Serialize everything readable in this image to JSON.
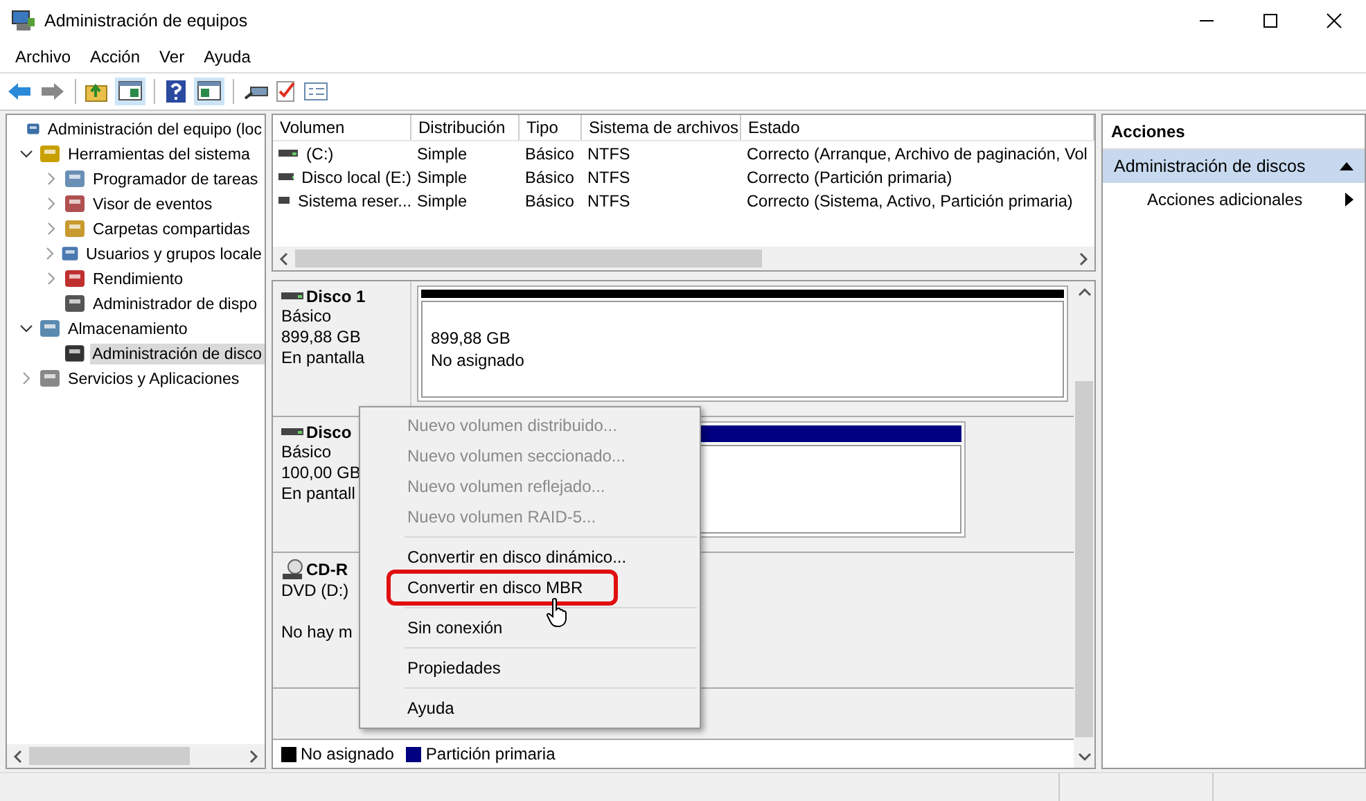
{
  "window": {
    "title": "Administración de equipos"
  },
  "menu": [
    "Archivo",
    "Acción",
    "Ver",
    "Ayuda"
  ],
  "tree": [
    {
      "label": "Administración del equipo (loc",
      "selected": false,
      "children": [
        {
          "label": "Herramientas del sistema",
          "expanded": true,
          "selected": false,
          "children": [
            {
              "label": "Programador de tareas",
              "expanded": false,
              "selected": false
            },
            {
              "label": "Visor de eventos",
              "expanded": false,
              "selected": false
            },
            {
              "label": "Carpetas compartidas",
              "expanded": false,
              "selected": false
            },
            {
              "label": "Usuarios y grupos locale",
              "expanded": false,
              "selected": false
            },
            {
              "label": "Rendimiento",
              "expanded": false,
              "selected": false
            },
            {
              "label": "Administrador de dispo",
              "selected": false
            }
          ]
        },
        {
          "label": "Almacenamiento",
          "expanded": true,
          "selected": false,
          "children": [
            {
              "label": "Administración de disco",
              "selected": true
            }
          ]
        },
        {
          "label": "Servicios y Aplicaciones",
          "expanded": false,
          "selected": false
        }
      ]
    }
  ],
  "volumes": {
    "columns": [
      "Volumen",
      "Distribución",
      "Tipo",
      "Sistema de archivos",
      "Estado"
    ],
    "rows": [
      [
        "(C:)",
        "Simple",
        "Básico",
        "NTFS",
        "Correcto (Arranque, Archivo de paginación, Vol"
      ],
      [
        "Disco local (E:)",
        "Simple",
        "Básico",
        "NTFS",
        "Correcto (Partición primaria)"
      ],
      [
        "Sistema reser...",
        "Simple",
        "Básico",
        "NTFS",
        "Correcto (Sistema, Activo, Partición primaria)"
      ]
    ]
  },
  "disks": [
    {
      "kind": "disk",
      "name": "Disco 1",
      "lines": [
        "Básico",
        "899,88 GB",
        "En pantalla"
      ],
      "partition": {
        "color": "#000000",
        "size": "899,88 GB",
        "status": "No asignado"
      }
    },
    {
      "kind": "disk",
      "name": "Disco",
      "lines": [
        "Básico",
        "100,00 GB",
        "En pantall"
      ],
      "partition": {
        "color": "#000080"
      }
    },
    {
      "kind": "cdrom",
      "name": "CD-R",
      "lines": [
        "DVD (D:)"
      ],
      "note": "No hay m"
    }
  ],
  "legend": [
    {
      "label": "No asignado",
      "color": "#000000"
    },
    {
      "label": "Partición primaria",
      "color": "#000080"
    }
  ],
  "context_menu": [
    [
      {
        "label": "Nuevo volumen distribuido...",
        "disabled": true,
        "selected": false
      },
      {
        "label": "Nuevo volumen seccionado...",
        "disabled": true,
        "selected": false
      },
      {
        "label": "Nuevo volumen reflejado...",
        "disabled": true,
        "selected": false
      },
      {
        "label": "Nuevo volumen RAID-5...",
        "disabled": true,
        "selected": false
      }
    ],
    [
      {
        "label": "Convertir en disco dinámico...",
        "disabled": false,
        "selected": false
      },
      {
        "label": "Convertir en disco MBR",
        "disabled": false,
        "selected": true
      }
    ],
    [
      {
        "label": "Sin conexión",
        "disabled": false,
        "selected": false
      }
    ],
    [
      {
        "label": "Propiedades",
        "disabled": false,
        "selected": false
      }
    ],
    [
      {
        "label": "Ayuda",
        "disabled": false,
        "selected": false
      }
    ]
  ],
  "actions": {
    "title": "Acciones",
    "section": {
      "label": "Administración de discos",
      "expanded": true
    },
    "items": [
      "Acciones adicionales"
    ]
  }
}
